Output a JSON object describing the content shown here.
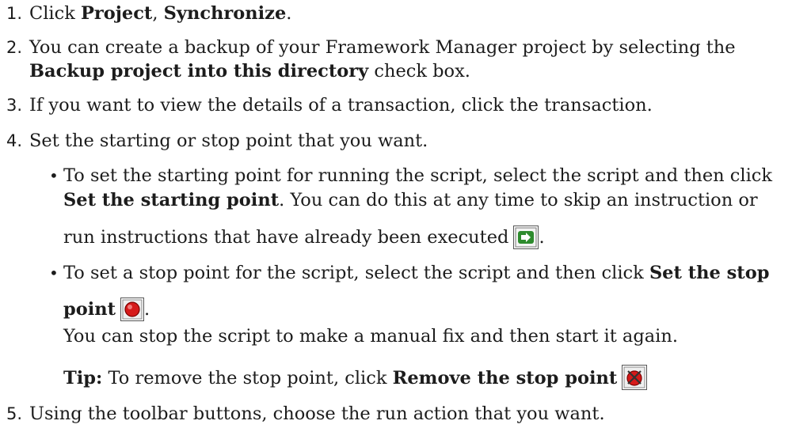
{
  "steps": [
    {
      "number": "1.",
      "pre": "Click ",
      "b1": "Project",
      "sep": ", ",
      "b2": "Synchronize",
      "post": "."
    },
    {
      "number": "2.",
      "line1": "You can create a backup of your Framework Manager project by selecting the",
      "b1": "Backup project into this directory",
      "post": " check box."
    },
    {
      "number": "3.",
      "text": "If you want to view the details of a transaction, click the transaction."
    },
    {
      "number": "4.",
      "text": "Set the starting or stop point that you want.",
      "bullets": [
        {
          "line1": "To set the starting point for running the script, select the script and then click",
          "b1": "Set the starting point",
          "line2": ". You can do this at any time to skip an instruction or",
          "line3": "run instructions that have already been executed",
          "end": ".",
          "icon": "set-starting-point-icon"
        },
        {
          "line1": "To set a stop point for the script, select the script and then click ",
          "b1": "Set the stop",
          "b2": "point",
          "end": ".",
          "icon": "stop-point-icon",
          "para": "You can stop the script to make a manual fix and then start it again.",
          "tip_label": "Tip:",
          "tip_text": " To remove the stop point, click ",
          "tip_bold": "Remove the stop point",
          "tip_icon": "remove-stop-point-icon"
        }
      ]
    },
    {
      "number": "5.",
      "text": "Using the toolbar buttons, choose the run action that you want."
    }
  ]
}
